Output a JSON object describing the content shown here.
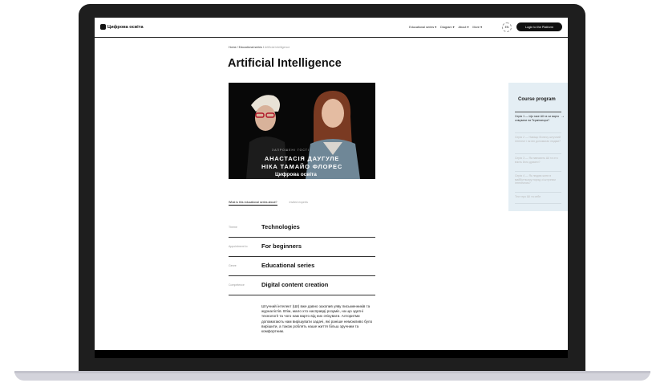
{
  "header": {
    "logo_text": "Цифрова освіта",
    "nav": [
      "Educational series ▾",
      "Diagram ▾",
      "About ▾",
      "More ▾"
    ],
    "lang": "EN",
    "login_label": "Login to the Platform"
  },
  "breadcrumb": {
    "items": [
      "Home",
      "Educational series",
      "Artificial intelligence"
    ],
    "separator": "/"
  },
  "title": "Artificial Intelligence",
  "hero": {
    "subtitle": "ЗАПРОШЕНІ ГОСТІ",
    "name1": "АНАСТАСІЯ ДАУГУЛЕ",
    "name2": "НІКА ТАМАЙО ФЛОРЕС",
    "brand": "Цифрова освіта"
  },
  "tabs": [
    "What is this educational series about?",
    "Invited experts"
  ],
  "properties": [
    {
      "label": "Theme",
      "value": "Technologies"
    },
    {
      "label": "Appointment to",
      "value": "For beginners"
    },
    {
      "label": "Genre",
      "value": "Educational series"
    },
    {
      "label": "Competence",
      "value": "Digital content creation"
    }
  ],
  "description": "Штучний інтелект (ШІ) вже давно захопив уяву письменників та журналістів. Втім, мало хто насправді розуміє, на що здатні технології та чого нам варто від них очікувати. Алгоритми допомагають нам вирішувати задачі, які раніше неможливо було вирішити, а також роблять наше життя більш зручним та комфортним.",
  "course": {
    "title": "Course program",
    "items": [
      "Серія 1 — Що таке ШІ та чи варто очікувати на Термінатора?",
      "Серія 2 — Навіщо бізнесу штучний інтелект і як він допомагає людям?",
      "Серія 3 — Як навчають ШІ та хто вчить його думати?",
      "Серія 4 — Як людям жити в майбутньому поряд зі штучним інтелектом?",
      "Тест про ШІ та себе"
    ]
  }
}
